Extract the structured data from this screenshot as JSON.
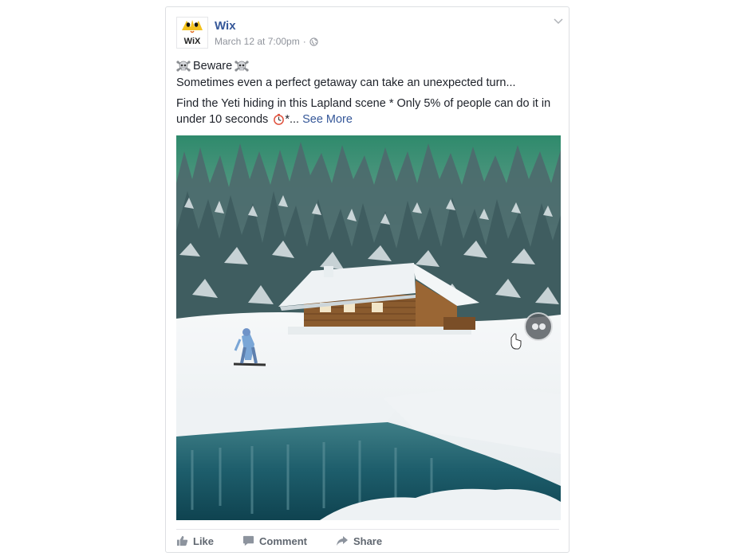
{
  "post": {
    "author": "Wix",
    "avatar_text": "WiX",
    "timestamp": "March 12 at 7:00pm",
    "separator": "·",
    "privacy_icon": "globe-icon",
    "menu_icon": "chevron-down-icon",
    "headline_emoji": "skull-and-crossbones-icon",
    "headline": "Beware",
    "line2": "Sometimes even a perfect getaway can take an unexpected turn...",
    "line3a": "Find the Yeti hiding in this Lapland scene * Only 5% of people can do it in",
    "line3b_prefix": "under 10 seconds",
    "line3b_suffix": "*...",
    "see_more": "See More"
  },
  "photo": {
    "overlay_icon": "gif-play-icon"
  },
  "actions": {
    "like": "Like",
    "comment": "Comment",
    "share": "Share"
  },
  "colors": {
    "link": "#365899",
    "meta": "#90949c",
    "text": "#1d2129",
    "border": "#dddfe2"
  }
}
